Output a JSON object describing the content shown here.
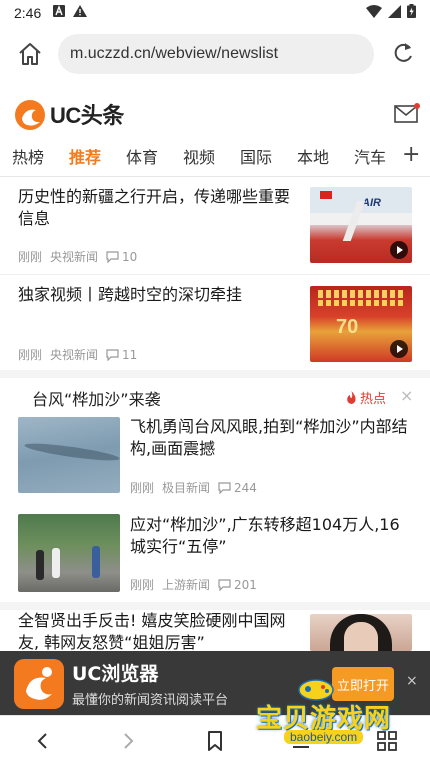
{
  "status_bar": {
    "time": "2:46"
  },
  "browser": {
    "url": "m.uczzd.cn/webview/newslist"
  },
  "header": {
    "logo_text": "UC头条"
  },
  "tabs": [
    "热榜",
    "推荐",
    "体育",
    "视频",
    "国际",
    "本地",
    "汽车"
  ],
  "active_tab": "推荐",
  "news": [
    {
      "title": "历史性的新疆之行开启，传递哪些重要信息",
      "time": "刚刚",
      "source": "央视新闻",
      "comments": "10",
      "thumb_text": "AIR",
      "has_video": true
    },
    {
      "title": "独家视频丨跨越时空的深切牵挂",
      "time": "刚刚",
      "source": "央视新闻",
      "comments": "11",
      "has_video": true
    }
  ],
  "topic": {
    "title": "台风“桦加沙”来袭",
    "hot_label": "热点",
    "items": [
      {
        "title": "飞机勇闯台风风眼,拍到“桦加沙”内部结构,画面震撼",
        "time": "刚刚",
        "source": "极目新闻",
        "comments": "244"
      },
      {
        "title": "应对“桦加沙”,广东转移超104万人,16城实行“五停”",
        "time": "刚刚",
        "source": "上游新闻",
        "comments": "201"
      }
    ]
  },
  "partial_news": {
    "title": "全智贤出手反击! 嬉皮笑脸硬刚中国网友, 韩网友怒赞“姐姐厉害”"
  },
  "banner": {
    "app_name": "UC浏览器",
    "app_desc": "最懂你的新闻资讯阅读平台",
    "open_label": "立即打开",
    "close_label": "×"
  },
  "watermark": {
    "text": "宝贝游戏网",
    "url": "baobeiy.com"
  },
  "colors": {
    "accent": "#f37b1d",
    "hot": "#e03c31",
    "banner_bg": "#282828",
    "open_btn": "#f59a23"
  }
}
